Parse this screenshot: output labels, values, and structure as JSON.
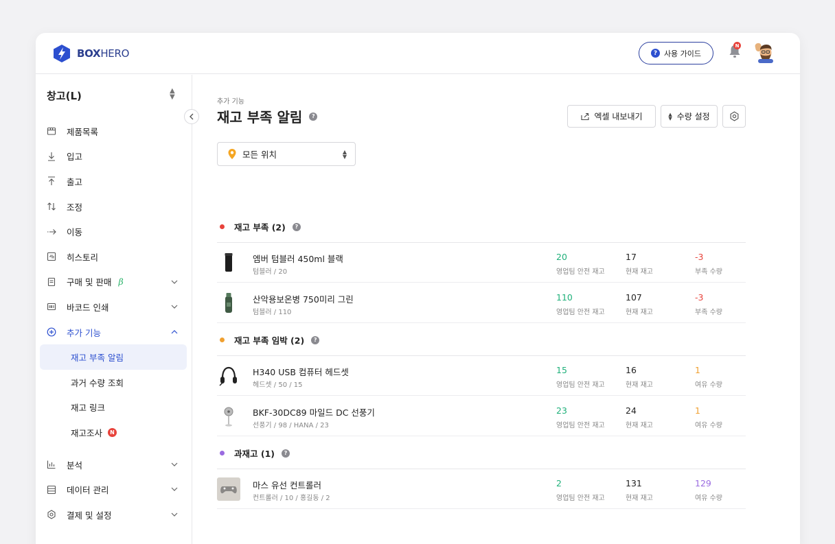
{
  "app": {
    "logo_bold": "BOX",
    "logo_light": "HERO"
  },
  "topbar": {
    "guide_label": "사용 가이드",
    "notification_badge": "N"
  },
  "sidebar": {
    "warehouse": "창고(L)",
    "items": [
      {
        "label": "제품목록",
        "icon": "box-icon"
      },
      {
        "label": "입고",
        "icon": "arrow-down-icon"
      },
      {
        "label": "출고",
        "icon": "arrow-up-icon"
      },
      {
        "label": "조정",
        "icon": "swap-icon"
      },
      {
        "label": "이동",
        "icon": "move-arrow-icon"
      },
      {
        "label": "히스토리",
        "icon": "history-icon"
      },
      {
        "label": "구매 및 판매",
        "icon": "document-icon",
        "beta": "β"
      },
      {
        "label": "바코드 인쇄",
        "icon": "barcode-icon"
      },
      {
        "label": "추가 기능",
        "icon": "plus-circle-icon"
      }
    ],
    "sub_items": [
      {
        "label": "재고 부족 알림"
      },
      {
        "label": "과거 수량 조회"
      },
      {
        "label": "재고 링크"
      },
      {
        "label": "재고조사",
        "badge": "N"
      }
    ],
    "bottom_items": [
      {
        "label": "분석",
        "icon": "chart-icon"
      },
      {
        "label": "데이터 관리",
        "icon": "database-icon"
      },
      {
        "label": "결제 및 설정",
        "icon": "gear-icon"
      }
    ]
  },
  "main": {
    "breadcrumb": "추가 기능",
    "title": "재고 부족 알림",
    "export_label": "엑셀 내보내기",
    "qty_setting_label": "수량 설정",
    "location_select": "모든 위치",
    "sections": [
      {
        "title": "재고 부족 (2)",
        "color": "#e8433b",
        "rows": [
          {
            "name": "엠버 텀블러 450ml 블랙",
            "sub": "텀블러 / 20",
            "safe": "20",
            "safe_label": "영업팀 안전 재고",
            "current": "17",
            "current_label": "현재 재고",
            "diff": "-3",
            "diff_label": "부족 수량"
          },
          {
            "name": "산악용보온병 750미리 그린",
            "sub": "텀블러 / 110",
            "safe": "110",
            "safe_label": "영업팀 안전 재고",
            "current": "107",
            "current_label": "현재 재고",
            "diff": "-3",
            "diff_label": "부족 수량"
          }
        ]
      },
      {
        "title": "재고 부족 임박 (2)",
        "color": "#f0a030",
        "rows": [
          {
            "name": "H340 USB 컴퓨터 헤드셋",
            "sub": "헤드셋 / 50 / 15",
            "safe": "15",
            "safe_label": "영업팀 안전 재고",
            "current": "16",
            "current_label": "현재 재고",
            "diff": "1",
            "diff_label": "여유 수량"
          },
          {
            "name": "BKF-30DC89 마일드 DC 선풍기",
            "sub": "선풍기 / 98 / HANA / 23",
            "safe": "23",
            "safe_label": "영업팀 안전 재고",
            "current": "24",
            "current_label": "현재 재고",
            "diff": "1",
            "diff_label": "여유 수량"
          }
        ]
      },
      {
        "title": "과재고 (1)",
        "color": "#9a6be0",
        "rows": [
          {
            "name": "마스 유선 컨트롤러",
            "sub": "컨트롤러 / 10 / 홍길동 / 2",
            "safe": "2",
            "safe_label": "영업팀 안전 재고",
            "current": "131",
            "current_label": "현재 재고",
            "diff": "129",
            "diff_label": "여유 수량"
          }
        ]
      }
    ]
  }
}
